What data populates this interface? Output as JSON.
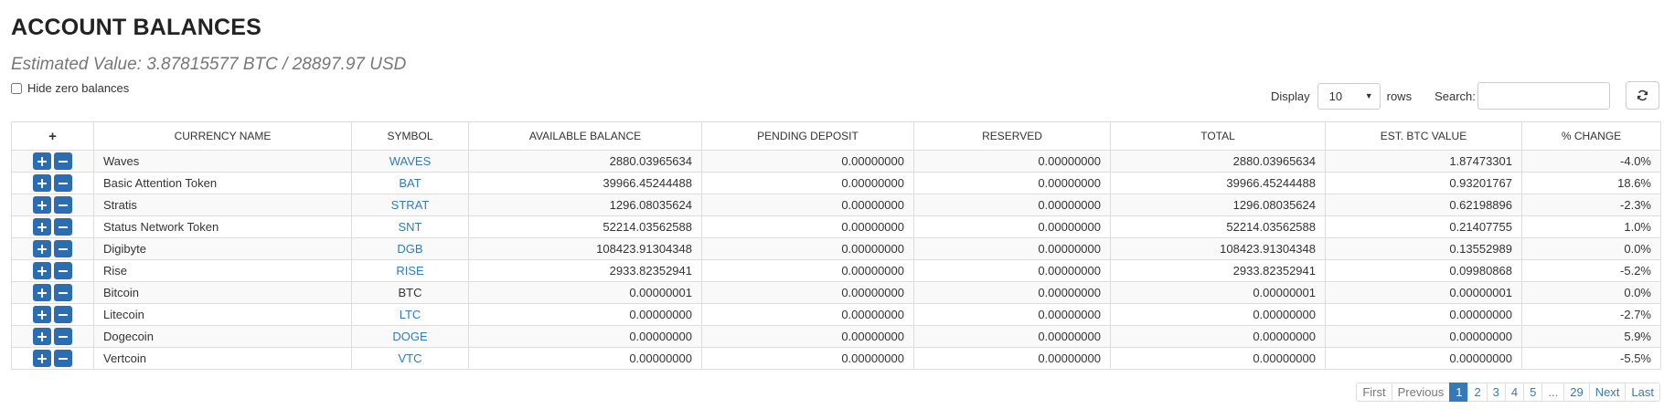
{
  "header": {
    "title": "ACCOUNT BALANCES",
    "estimated_value": "Estimated Value: 3.87815577 BTC / 28897.97 USD",
    "hide_zero_label": "Hide zero balances"
  },
  "controls": {
    "display_label": "Display",
    "rows_value": "10",
    "rows_label": "rows",
    "search_label": "Search:",
    "search_value": ""
  },
  "table": {
    "columns": {
      "plus": "+",
      "currency_name": "CURRENCY NAME",
      "symbol": "SYMBOL",
      "available_balance": "AVAILABLE BALANCE",
      "pending_deposit": "PENDING DEPOSIT",
      "reserved": "RESERVED",
      "total": "TOTAL",
      "est_btc_value": "EST. BTC VALUE",
      "pct_change": "% CHANGE"
    },
    "rows": [
      {
        "name": "Waves",
        "symbol": "WAVES",
        "link": true,
        "available": "2880.03965634",
        "pending": "0.00000000",
        "reserved": "0.00000000",
        "total": "2880.03965634",
        "btc": "1.87473301",
        "change": "-4.0%"
      },
      {
        "name": "Basic Attention Token",
        "symbol": "BAT",
        "link": true,
        "available": "39966.45244488",
        "pending": "0.00000000",
        "reserved": "0.00000000",
        "total": "39966.45244488",
        "btc": "0.93201767",
        "change": "18.6%"
      },
      {
        "name": "Stratis",
        "symbol": "STRAT",
        "link": true,
        "available": "1296.08035624",
        "pending": "0.00000000",
        "reserved": "0.00000000",
        "total": "1296.08035624",
        "btc": "0.62198896",
        "change": "-2.3%"
      },
      {
        "name": "Status Network Token",
        "symbol": "SNT",
        "link": true,
        "available": "52214.03562588",
        "pending": "0.00000000",
        "reserved": "0.00000000",
        "total": "52214.03562588",
        "btc": "0.21407755",
        "change": "1.0%"
      },
      {
        "name": "Digibyte",
        "symbol": "DGB",
        "link": true,
        "available": "108423.91304348",
        "pending": "0.00000000",
        "reserved": "0.00000000",
        "total": "108423.91304348",
        "btc": "0.13552989",
        "change": "0.0%"
      },
      {
        "name": "Rise",
        "symbol": "RISE",
        "link": true,
        "available": "2933.82352941",
        "pending": "0.00000000",
        "reserved": "0.00000000",
        "total": "2933.82352941",
        "btc": "0.09980868",
        "change": "-5.2%"
      },
      {
        "name": "Bitcoin",
        "symbol": "BTC",
        "link": false,
        "available": "0.00000001",
        "pending": "0.00000000",
        "reserved": "0.00000000",
        "total": "0.00000001",
        "btc": "0.00000001",
        "change": "0.0%"
      },
      {
        "name": "Litecoin",
        "symbol": "LTC",
        "link": true,
        "available": "0.00000000",
        "pending": "0.00000000",
        "reserved": "0.00000000",
        "total": "0.00000000",
        "btc": "0.00000000",
        "change": "-2.7%"
      },
      {
        "name": "Dogecoin",
        "symbol": "DOGE",
        "link": true,
        "available": "0.00000000",
        "pending": "0.00000000",
        "reserved": "0.00000000",
        "total": "0.00000000",
        "btc": "0.00000000",
        "change": "5.9%"
      },
      {
        "name": "Vertcoin",
        "symbol": "VTC",
        "link": true,
        "available": "0.00000000",
        "pending": "0.00000000",
        "reserved": "0.00000000",
        "total": "0.00000000",
        "btc": "0.00000000",
        "change": "-5.5%"
      }
    ]
  },
  "pagination": [
    {
      "label": "First",
      "state": "disabled",
      "key": "first"
    },
    {
      "label": "Previous",
      "state": "disabled",
      "key": "previous"
    },
    {
      "label": "1",
      "state": "active",
      "key": "1"
    },
    {
      "label": "2",
      "state": "normal",
      "key": "2"
    },
    {
      "label": "3",
      "state": "normal",
      "key": "3"
    },
    {
      "label": "4",
      "state": "normal",
      "key": "4"
    },
    {
      "label": "5",
      "state": "normal",
      "key": "5"
    },
    {
      "label": "...",
      "state": "disabled",
      "key": "ellipsis"
    },
    {
      "label": "29",
      "state": "normal",
      "key": "29"
    },
    {
      "label": "Next",
      "state": "normal",
      "key": "next"
    },
    {
      "label": "Last",
      "state": "normal",
      "key": "last"
    }
  ],
  "colors": {
    "accent": "#337ab7",
    "action_button": "#2a6db3",
    "border": "#dddddd",
    "stripe": "#f9f9f9"
  },
  "icons": {
    "expand": "plus-icon",
    "collapse": "minus-icon",
    "refresh": "refresh-icon",
    "dropdown": "caret-down-icon"
  }
}
